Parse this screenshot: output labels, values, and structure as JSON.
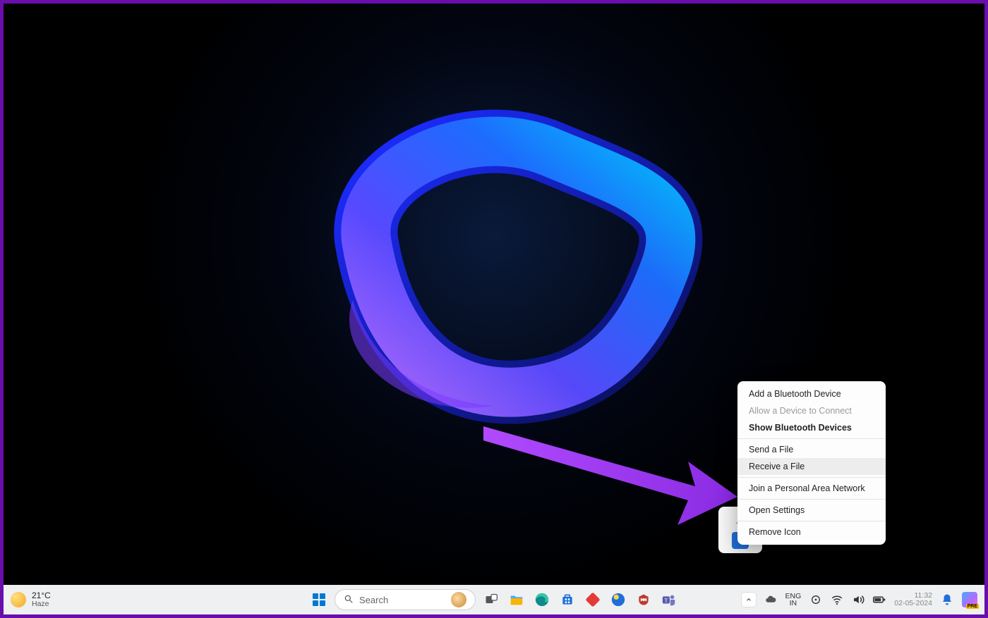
{
  "weather": {
    "temp": "21°C",
    "condition": "Haze"
  },
  "search": {
    "placeholder": "Search"
  },
  "language": {
    "top": "ENG",
    "bottom": "IN"
  },
  "clock": {
    "time": "11:32",
    "date": "02-05-2024"
  },
  "copilot_badge": "PRE",
  "context_menu": {
    "items": [
      {
        "label": "Add a Bluetooth Device",
        "disabled": false,
        "bold": false,
        "hover": false,
        "sep_after": false
      },
      {
        "label": "Allow a Device to Connect",
        "disabled": true,
        "bold": false,
        "hover": false,
        "sep_after": false
      },
      {
        "label": "Show Bluetooth Devices",
        "disabled": false,
        "bold": true,
        "hover": false,
        "sep_after": true
      },
      {
        "label": "Send a File",
        "disabled": false,
        "bold": false,
        "hover": false,
        "sep_after": false
      },
      {
        "label": "Receive a File",
        "disabled": false,
        "bold": false,
        "hover": true,
        "sep_after": true
      },
      {
        "label": "Join a Personal Area Network",
        "disabled": false,
        "bold": false,
        "hover": false,
        "sep_after": true
      },
      {
        "label": "Open Settings",
        "disabled": false,
        "bold": false,
        "hover": false,
        "sep_after": true
      },
      {
        "label": "Remove Icon",
        "disabled": false,
        "bold": false,
        "hover": false,
        "sep_after": false
      }
    ]
  }
}
